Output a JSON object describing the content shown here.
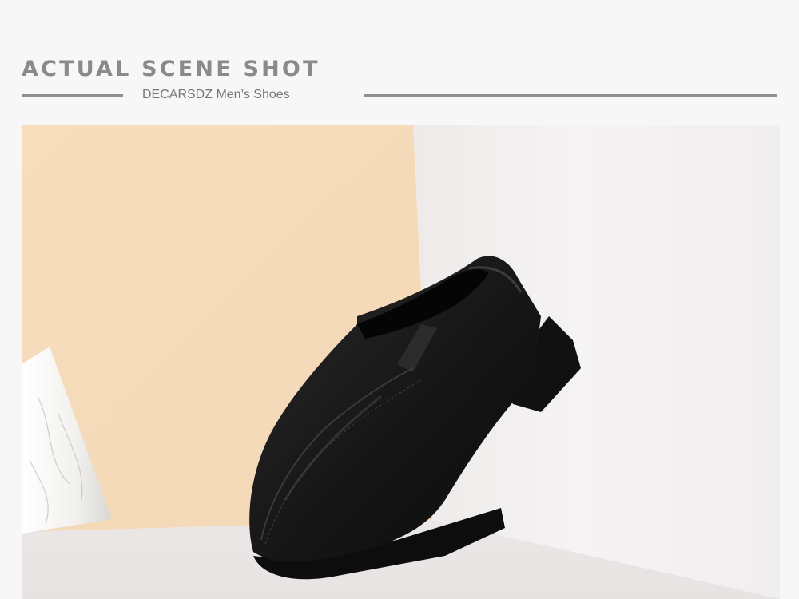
{
  "banner": {
    "title": "ACTUAL SCENE SHOT",
    "subtitle": "DECARSDZ Men’s Shoes"
  },
  "photo": {
    "subject": "shoe-photo",
    "colors": {
      "peach_wall": "#f6dcba",
      "white_wall": "#f3f1f1",
      "floor": "#eeeaea",
      "shoe": "#151515",
      "title_gray": "#8a8a8a"
    }
  }
}
